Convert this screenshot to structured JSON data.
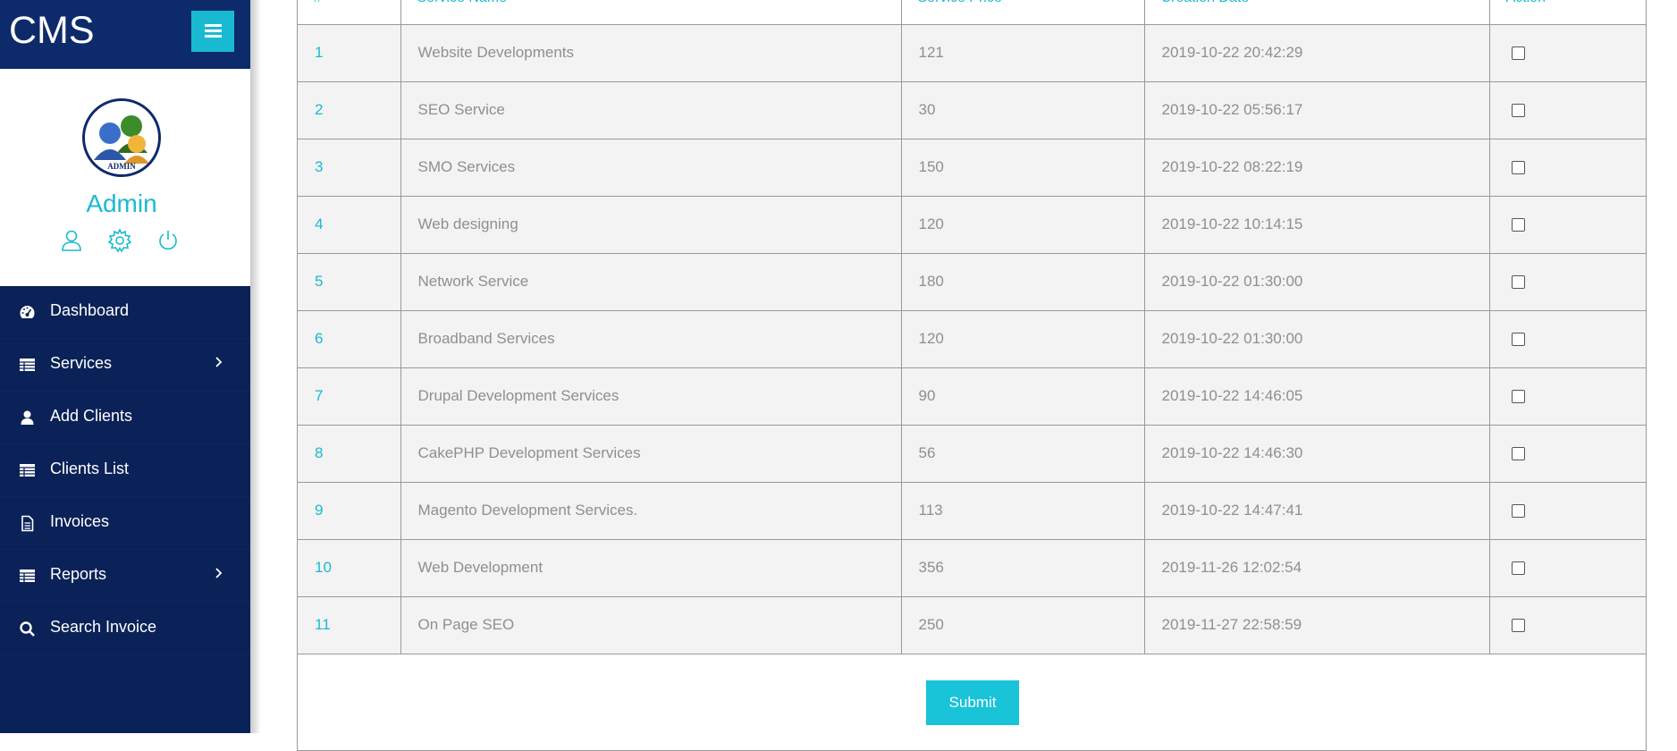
{
  "brand": {
    "name": "CMS"
  },
  "profile": {
    "name": "Admin",
    "avatar_text": "ADMIN"
  },
  "profile_icons": [
    {
      "name": "user-icon"
    },
    {
      "name": "gear-icon"
    },
    {
      "name": "power-icon"
    }
  ],
  "nav": {
    "items": [
      {
        "label": "Dashboard",
        "icon": "dashboard-icon",
        "has_submenu": false
      },
      {
        "label": "Services",
        "icon": "table-icon",
        "has_submenu": true
      },
      {
        "label": "Add Clients",
        "icon": "user-icon",
        "has_submenu": false
      },
      {
        "label": "Clients List",
        "icon": "table-icon",
        "has_submenu": false
      },
      {
        "label": "Invoices",
        "icon": "file-icon",
        "has_submenu": false
      },
      {
        "label": "Reports",
        "icon": "table-icon",
        "has_submenu": true
      },
      {
        "label": "Search Invoice",
        "icon": "search-icon",
        "has_submenu": false
      }
    ]
  },
  "table": {
    "headers": [
      "#",
      "Service Name",
      "Service Price",
      "Creation Date",
      "Action"
    ],
    "rows": [
      [
        "1",
        "Website Developments",
        "121",
        "2019-10-22 20:42:29"
      ],
      [
        "2",
        "SEO Service",
        "30",
        "2019-10-22 05:56:17"
      ],
      [
        "3",
        "SMO Services",
        "150",
        "2019-10-22 08:22:19"
      ],
      [
        "4",
        "Web designing",
        "120",
        "2019-10-22 10:14:15"
      ],
      [
        "5",
        "Network Service",
        "180",
        "2019-10-22 01:30:00"
      ],
      [
        "6",
        "Broadband Services",
        "120",
        "2019-10-22 01:30:00"
      ],
      [
        "7",
        "Drupal Development Services",
        "90",
        "2019-10-22 14:46:05"
      ],
      [
        "8",
        "CakePHP Development Services",
        "56",
        "2019-10-22 14:46:30"
      ],
      [
        "9",
        "Magento Development Services.",
        "113",
        "2019-10-22 14:47:41"
      ],
      [
        "10",
        "Web Development",
        "356",
        "2019-11-26 12:02:54"
      ],
      [
        "11",
        "On Page SEO",
        "250",
        "2019-11-27 22:58:59"
      ]
    ]
  },
  "submit": {
    "label": "Submit"
  },
  "colors": {
    "sidebar": "#0a2257",
    "brand": "#0d2a6b",
    "accent": "#19bad1",
    "row_bg": "#f3f3f3"
  }
}
